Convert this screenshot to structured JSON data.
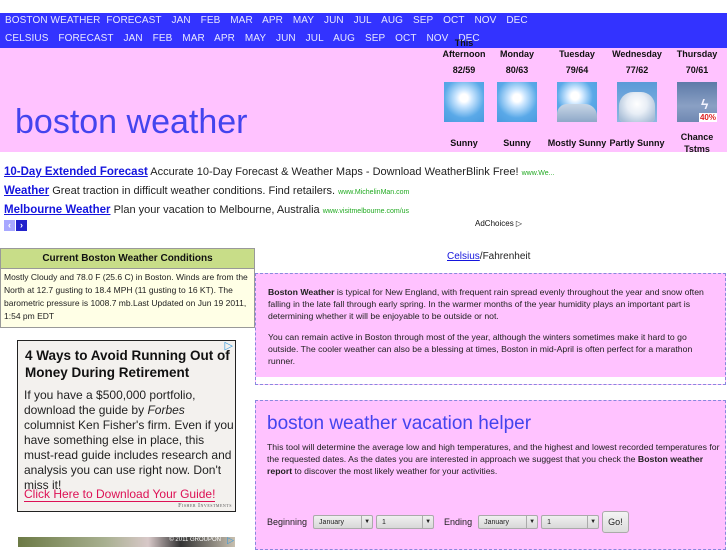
{
  "nav": {
    "row1": [
      "BOSTON WEATHER",
      "FORECAST",
      "JAN",
      "FEB",
      "MAR",
      "APR",
      "MAY",
      "JUN",
      "JUL",
      "AUG",
      "SEP",
      "OCT",
      "NOV",
      "DEC"
    ],
    "row2": [
      "CELSIUS",
      "FORECAST",
      "JAN",
      "FEB",
      "MAR",
      "APR",
      "MAY",
      "JUN",
      "JUL",
      "AUG",
      "SEP",
      "OCT",
      "NOV",
      "DEC"
    ]
  },
  "site_title": "boston weather",
  "forecast": [
    {
      "day": "This Afternoon",
      "temp": "82/59",
      "icon": "sunny-icon",
      "condition": "Sunny"
    },
    {
      "day": "Monday",
      "temp": "80/63",
      "icon": "sunny-icon",
      "condition": "Sunny"
    },
    {
      "day": "Tuesday",
      "temp": "79/64",
      "icon": "mostly-sunny-icon",
      "condition": "Mostly Sunny"
    },
    {
      "day": "Wednesday",
      "temp": "77/62",
      "icon": "partly-sunny-icon",
      "condition": "Partly Sunny"
    },
    {
      "day": "Thursday",
      "temp": "70/61",
      "icon": "thunderstorm-icon",
      "condition": "Chance Tstms",
      "precip": "40%"
    }
  ],
  "ads": [
    {
      "title": "10-Day Extended Forecast",
      "text": "Accurate 10-Day Forecast & Weather Maps - Download WeatherBlink Free!",
      "url": "www.We..."
    },
    {
      "title": "Weather",
      "text": "Great traction in difficult weather conditions. Find retailers.",
      "url": "www.MichelinMan.com"
    },
    {
      "title": "Melbourne Weather",
      "text": "Plan your vacation to Melbourne, Australia",
      "url": "www.visitmelbourne.com/us"
    }
  ],
  "ad_nav": {
    "prev": "‹",
    "next": "›"
  },
  "adchoices": "AdChoices ▷",
  "conditions": {
    "title": "Current Boston Weather Conditions",
    "text": "Mostly Cloudy and 78.0 F (25.6 C) in Boston. Winds are from the North at 12.7 gusting to 18.4 MPH (11 gusting to 16 KT). The barometric pressure is 1008.7 mb.Last Updated on Jun 19 2011, 1:54 pm EDT"
  },
  "display_ad": {
    "headline": "4 Ways to Avoid Running Out of Money During Retirement",
    "body_pre": "If you have a $500,000 portfolio, download the guide by ",
    "body_em": "Forbes",
    "body_post": " columnist Ken Fisher's firm. Even if you have something else in place, this must-read guide includes research and analysis you can use right now. Don't miss it!",
    "cta": "Click Here to Download Your Guide!",
    "brand": "Fisher Investments"
  },
  "banner_ad": {
    "copyright": "© 2011 GROUPON"
  },
  "unit_toggle": {
    "celsius": "Celsius",
    "sep": "/",
    "fahrenheit": "Fahrenheit"
  },
  "info": {
    "p1_bold": "Boston Weather",
    "p1": " is typical for New England, with frequent rain spread evenly throughout the year and snow often falling in the late fall through early spring. In the warmer months of the year humidity plays an important part is determining whether it will be enjoyable to be outside or not.",
    "p2": "You can remain active in Boston through most of the year, although the winters sometimes make it hard to go outside. The cooler weather can also be a blessing at times, Boston in mid-April is often perfect for a marathon runner."
  },
  "vacation": {
    "title": "boston weather vacation helper",
    "desc_pre": "This tool will determine the average low and high temperatures, and the highest and lowest recorded temperatures for the requested dates. As the dates you are interested in approach we suggest that you check the ",
    "desc_bold": "Boston weather report",
    "desc_post": " to discover the most likely weather for your activities.",
    "beginning_label": "Beginning",
    "ending_label": "Ending",
    "begin_month": "January",
    "begin_day": "1",
    "end_month": "January",
    "end_day": "1",
    "go_label": "Go!"
  }
}
